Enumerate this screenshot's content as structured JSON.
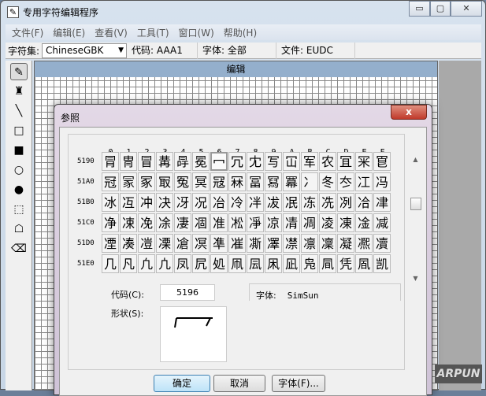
{
  "window": {
    "title": "专用字符编辑程序",
    "minimize": "▭",
    "maximize": "▢",
    "close": "✕"
  },
  "menu": [
    "文件(F)",
    "编辑(E)",
    "查看(V)",
    "工具(T)",
    "窗口(W)",
    "帮助(H)"
  ],
  "toolbar": {
    "charset_label": "字符集:",
    "charset_value": "ChineseGBK",
    "code": "代码: AAA1",
    "font": "字体: 全部",
    "file": "文件: EUDC"
  },
  "tools": [
    {
      "name": "pencil-icon",
      "glyph": "✎"
    },
    {
      "name": "brush-icon",
      "glyph": "♜"
    },
    {
      "name": "line-icon",
      "glyph": "╲"
    },
    {
      "name": "rectangle-icon",
      "glyph": "□"
    },
    {
      "name": "filled-rectangle-icon",
      "glyph": "■"
    },
    {
      "name": "ellipse-icon",
      "glyph": "○"
    },
    {
      "name": "filled-ellipse-icon",
      "glyph": "●"
    },
    {
      "name": "rect-select-icon",
      "glyph": "⬚"
    },
    {
      "name": "freeform-select-icon",
      "glyph": "☖"
    },
    {
      "name": "eraser-icon",
      "glyph": "⌫"
    }
  ],
  "edit": {
    "title": "编辑"
  },
  "dialog": {
    "title": "参照",
    "close": "x",
    "columns": [
      "0",
      "1",
      "2",
      "3",
      "4",
      "5",
      "6",
      "7",
      "8",
      "9",
      "A",
      "B",
      "C",
      "D",
      "E",
      "F"
    ],
    "rows": [
      {
        "code": "5190",
        "chars": "冐冑冒冓冔冕冖冗冘写冚军农冝冞冟"
      },
      {
        "code": "51A0",
        "chars": "冠冡冢冣冤冥冦冧冨冩冪冫冬冭冮冯"
      },
      {
        "code": "51B0",
        "chars": "冰冱冲决冴况冶冷冸冹冺冻冼冽冾冿"
      },
      {
        "code": "51C0",
        "chars": "净凁凂凃凄凅准凇凈凉凊凋凌凍凎减"
      },
      {
        "code": "51D0",
        "chars": "凐凑凒凓凔凕凖凗凘凙凚凛凜凝凞凟"
      },
      {
        "code": "51E0",
        "chars": "几凡凢凣凤凥処凧凨凩凪凫凬凭凮凯"
      }
    ],
    "selected": {
      "row": 0,
      "col": 6
    },
    "code_label": "代码(C):",
    "code_value": "5196",
    "shape_label": "形状(S):",
    "font_label": "字体:",
    "font_value": "SimSun",
    "ok": "确定",
    "cancel": "取消",
    "font_button": "字体(F)..."
  },
  "watermark": "ARPUN"
}
